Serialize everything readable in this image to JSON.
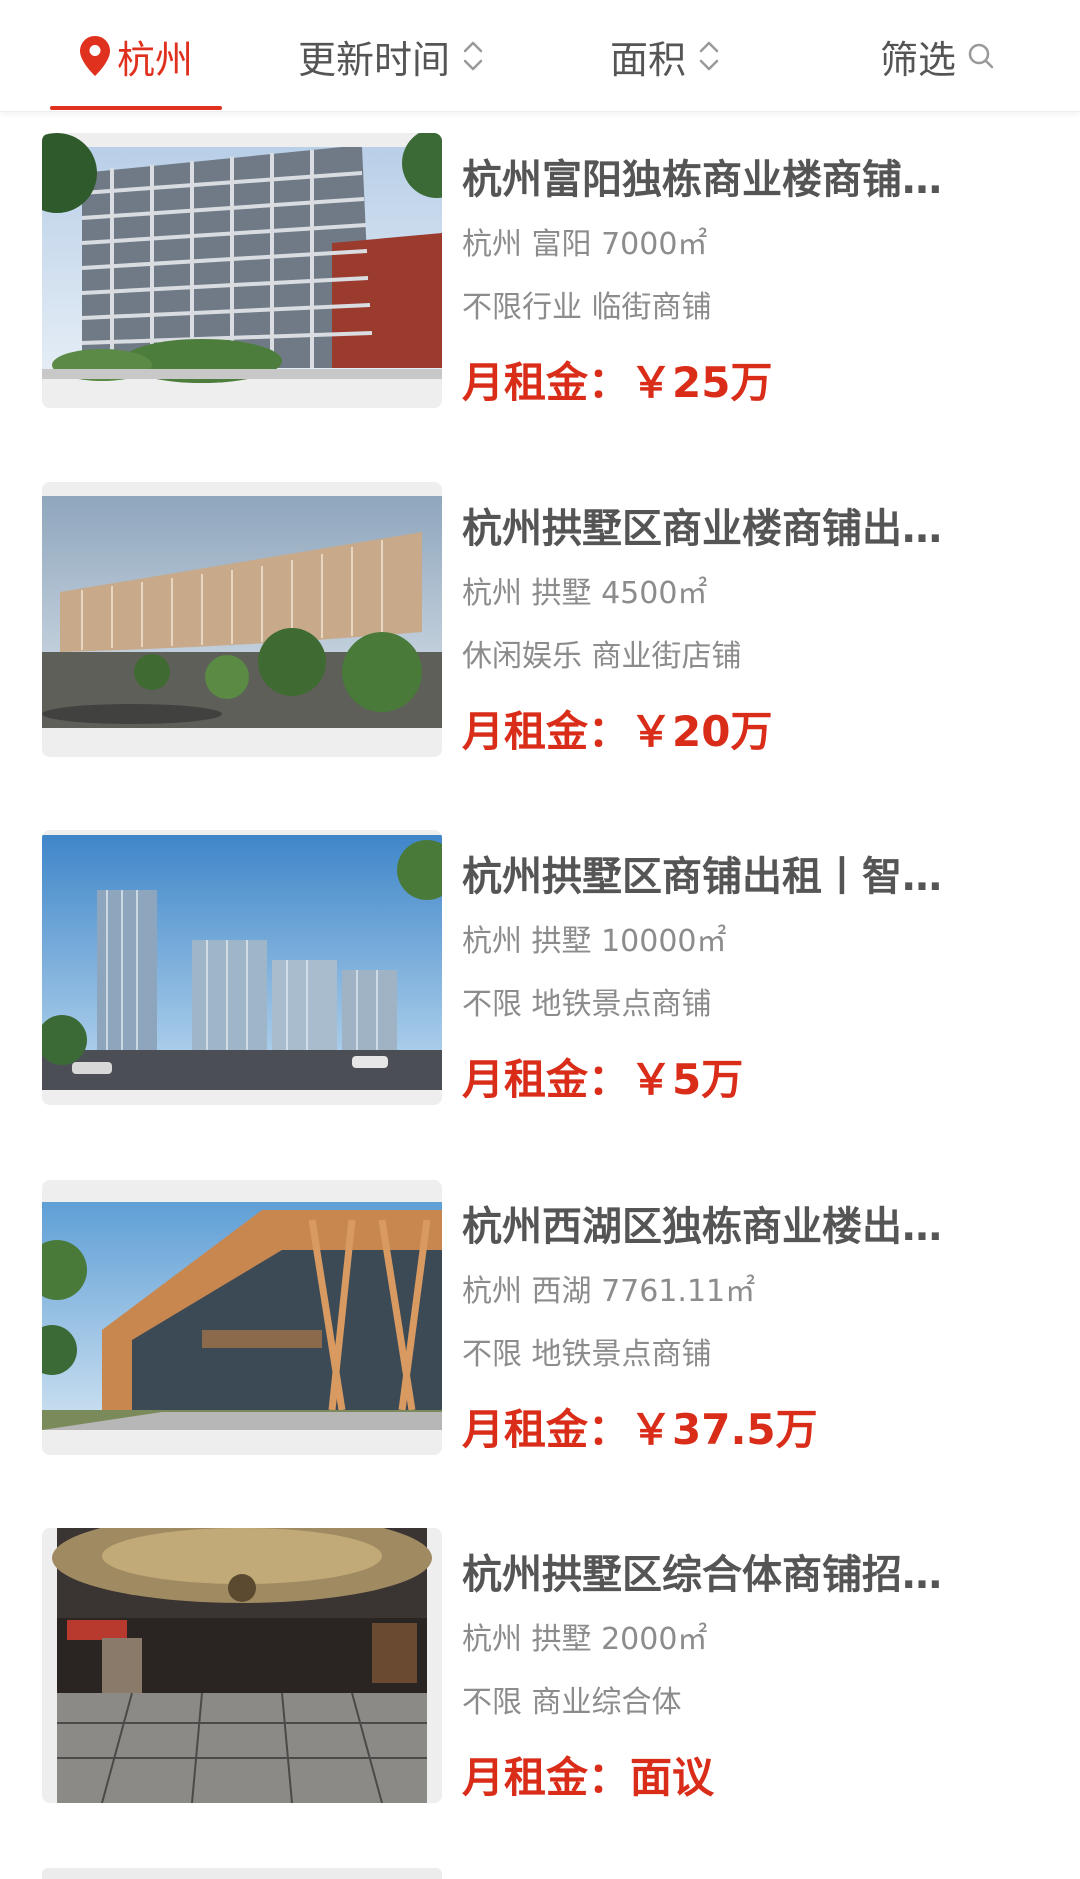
{
  "filter_bar": {
    "city": "杭州",
    "sort_time": "更新时间",
    "sort_area": "面积",
    "filter": "筛选",
    "accent_color": "#e0301e"
  },
  "listings": [
    {
      "title": "杭州富阳独栋商业楼商铺…",
      "location_area": "杭州 富阳 7000㎡",
      "tags": "不限行业 临街商铺",
      "price": "月租金：￥25万",
      "image": "glass-office-building"
    },
    {
      "title": "杭州拱墅区商业楼商铺出…",
      "location_area": "杭州 拱墅 4500㎡",
      "tags": "休闲娱乐 商业街店铺",
      "price": "月租金：￥20万",
      "image": "curved-commercial-building"
    },
    {
      "title": "杭州拱墅区商铺出租丨智…",
      "location_area": "杭州 拱墅 10000㎡",
      "tags": "不限 地铁景点商铺",
      "price": "月租金：￥5万",
      "image": "high-rise-towers"
    },
    {
      "title": "杭州西湖区独栋商业楼出…",
      "location_area": "杭州 西湖 7761.11㎡",
      "tags": "不限 地铁景点商铺",
      "price": "月租金：￥37.5万",
      "image": "wooden-facade-building"
    },
    {
      "title": "杭州拱墅区综合体商铺招…",
      "location_area": "杭州 拱墅 2000㎡",
      "tags": "不限 商业综合体",
      "price": "月租金：面议",
      "image": "interior-lobby"
    }
  ]
}
